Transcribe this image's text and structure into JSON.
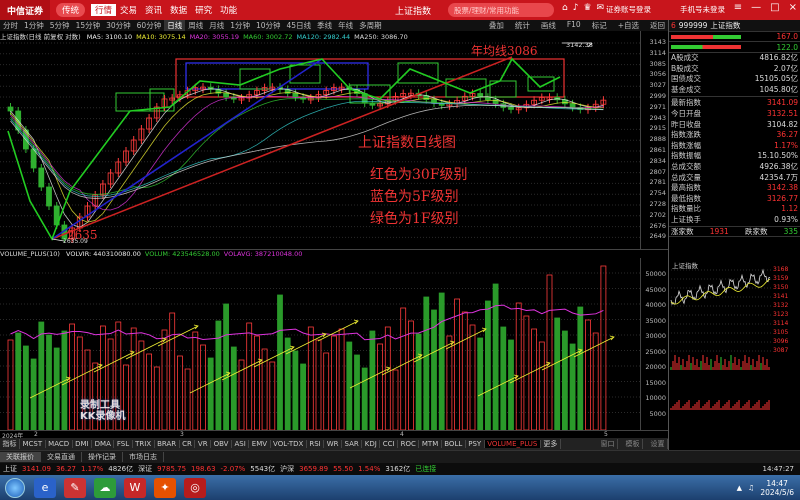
{
  "app": {
    "logo": "中信证券",
    "mode": "传统",
    "menu": [
      "行情",
      "交易",
      "资讯",
      "数据",
      "研究",
      "功能"
    ],
    "active_menu": "行情",
    "title": "上证指数",
    "search_placeholder": "股票/理财/常用功能",
    "top_right": "证券账号登录",
    "login": "手机号未登录",
    "icons": [
      "home-icon",
      "bell-icon",
      "trophy-icon",
      "mail-icon",
      "headset-icon"
    ],
    "window_buttons": [
      "≡",
      "—",
      "□",
      "×"
    ]
  },
  "periods": [
    "分时",
    "1分钟",
    "5分钟",
    "15分钟",
    "30分钟",
    "60分钟",
    "日线",
    "周线",
    "月线",
    "1分钟",
    "10分钟",
    "45日线",
    "季线",
    "年线",
    "多周期"
  ],
  "active_period": "日线",
  "period_right": [
    "叠加",
    "统计",
    "画线",
    "F10",
    "标记",
    "+自选",
    "返回"
  ],
  "indicator_line": {
    "name": "上证指数(日线 前复权 对数)",
    "items": [
      {
        "k": "MA5:",
        "v": "3100.10",
        "color": "#eeeeee"
      },
      {
        "k": "MA10:",
        "v": "3075.14",
        "color": "#eeee33"
      },
      {
        "k": "MA20:",
        "v": "3055.19",
        "color": "#dd33dd"
      },
      {
        "k": "MA60:",
        "v": "3002.72",
        "color": "#33cc33"
      },
      {
        "k": "MA120:",
        "v": "2982.44",
        "color": "#33cccc"
      },
      {
        "k": "MA250:",
        "v": "3086.70",
        "color": "#dddddd"
      }
    ]
  },
  "annotations": {
    "year_line": "年均线3086",
    "title": "上证指数日线图",
    "red": "红色为30F级别",
    "blue": "蓝色为5F级别",
    "green": "绿色为1F级别",
    "low": "2635",
    "low_small": "2635.09",
    "high": "3142.38",
    "watermark1": "录制工具",
    "watermark2": "KK录像机"
  },
  "price_ticks": [
    "3143",
    "3114",
    "3085",
    "3056",
    "3027",
    "2999",
    "2971",
    "2943",
    "2915",
    "2888",
    "2861",
    "2834",
    "2807",
    "2781",
    "2754",
    "2728",
    "2702",
    "2676",
    "2649"
  ],
  "volume_header": {
    "name": "VOLUME_PLUS(10)",
    "items": [
      {
        "k": "VOLVIR:",
        "v": "440310080.00",
        "color": "#eeeeee"
      },
      {
        "k": "VOLUM:",
        "v": "423546528.00",
        "color": "#33cc33"
      },
      {
        "k": "VOLAVG:",
        "v": "387210048.00",
        "color": "#dd33dd"
      }
    ]
  },
  "volume_ticks": [
    "50000",
    "45000",
    "40000",
    "35000",
    "30000",
    "25000",
    "20000",
    "15000",
    "10000",
    "5000"
  ],
  "volume_unit": "×10000",
  "x_labels": [
    "2024年",
    "2",
    "3",
    "4",
    "5"
  ],
  "indicator_tabs": [
    "指标",
    "MCST",
    "MACD",
    "DMI",
    "DMA",
    "FSL",
    "TRIX",
    "BRAR",
    "CR",
    "VR",
    "OBV",
    "ASI",
    "EMV",
    "VOL-TDX",
    "RSI",
    "WR",
    "SAR",
    "KDJ",
    "CCI",
    "ROC",
    "MTM",
    "BOLL",
    "PSY",
    "VOLUME_PLUS",
    "更多"
  ],
  "active_tab": "VOLUME_PLUS",
  "tabs_right": [
    "窗口",
    "模板",
    "设置"
  ],
  "bottom_tabs": [
    "关联报价",
    "交易直通",
    "操作记录",
    "市场日志"
  ],
  "status": {
    "sh_label": "上证",
    "sh": "3141.09",
    "sh_chg": "36.27",
    "sh_pct": "1.17%",
    "sh_vol": "4826亿",
    "sz_label": "深证",
    "sz": "9785.75",
    "sz_chg": "198.63",
    "sz_pct": "-2.07%",
    "sz_vol": "5543亿",
    "sh300_label": "沪深",
    "sh300": "3659.89",
    "sh300_chg": "55.50",
    "sh300_pct": "1.54%",
    "sh300_vol": "3162亿",
    "conn": "已连接"
  },
  "quote": {
    "code": "999999",
    "name": "上证指数",
    "up_label": "167.0",
    "down_label": "122.0",
    "rows": [
      {
        "l": "A股成交",
        "v": "4816.82亿",
        "c": "w"
      },
      {
        "l": "B股成交",
        "v": "2.07亿",
        "c": "w"
      },
      {
        "l": "国债成交",
        "v": "15105.05亿",
        "c": "w"
      },
      {
        "l": "基金成交",
        "v": "1045.80亿",
        "c": "w"
      },
      {
        "l": "最新指数",
        "v": "3141.09",
        "c": "r"
      },
      {
        "l": "今日开盘",
        "v": "3132.51",
        "c": "r"
      },
      {
        "l": "昨日收盘",
        "v": "3104.82",
        "c": "w"
      },
      {
        "l": "指数涨跌",
        "v": "36.27",
        "c": "r"
      },
      {
        "l": "指数涨幅",
        "v": "1.17%",
        "c": "r"
      },
      {
        "l": "指数振幅",
        "v": "15.10.50%",
        "c": "w"
      },
      {
        "l": "总成交额",
        "v": "4926.38亿",
        "c": "w"
      },
      {
        "l": "总成交量",
        "v": "42354.7万",
        "c": "w"
      },
      {
        "l": "最高指数",
        "v": "3142.38",
        "c": "r"
      },
      {
        "l": "最低指数",
        "v": "3126.77",
        "c": "r"
      },
      {
        "l": "指数量比",
        "v": "1.12",
        "c": "r"
      },
      {
        "l": "上证换手",
        "v": "0.93%",
        "c": "w"
      }
    ],
    "up_count_label": "涨家数",
    "up_count": "1931",
    "down_count_label": "跌家数",
    "down_count": "335",
    "mini_label": "上证指数",
    "mini_ticks": [
      "3168",
      "3159",
      "3150",
      "3141",
      "3132",
      "3123",
      "3114",
      "3105",
      "3096",
      "3087"
    ]
  },
  "taskbar": {
    "time": "14:47",
    "date": "2024/5/6",
    "clock_top": "14:47:27"
  }
}
